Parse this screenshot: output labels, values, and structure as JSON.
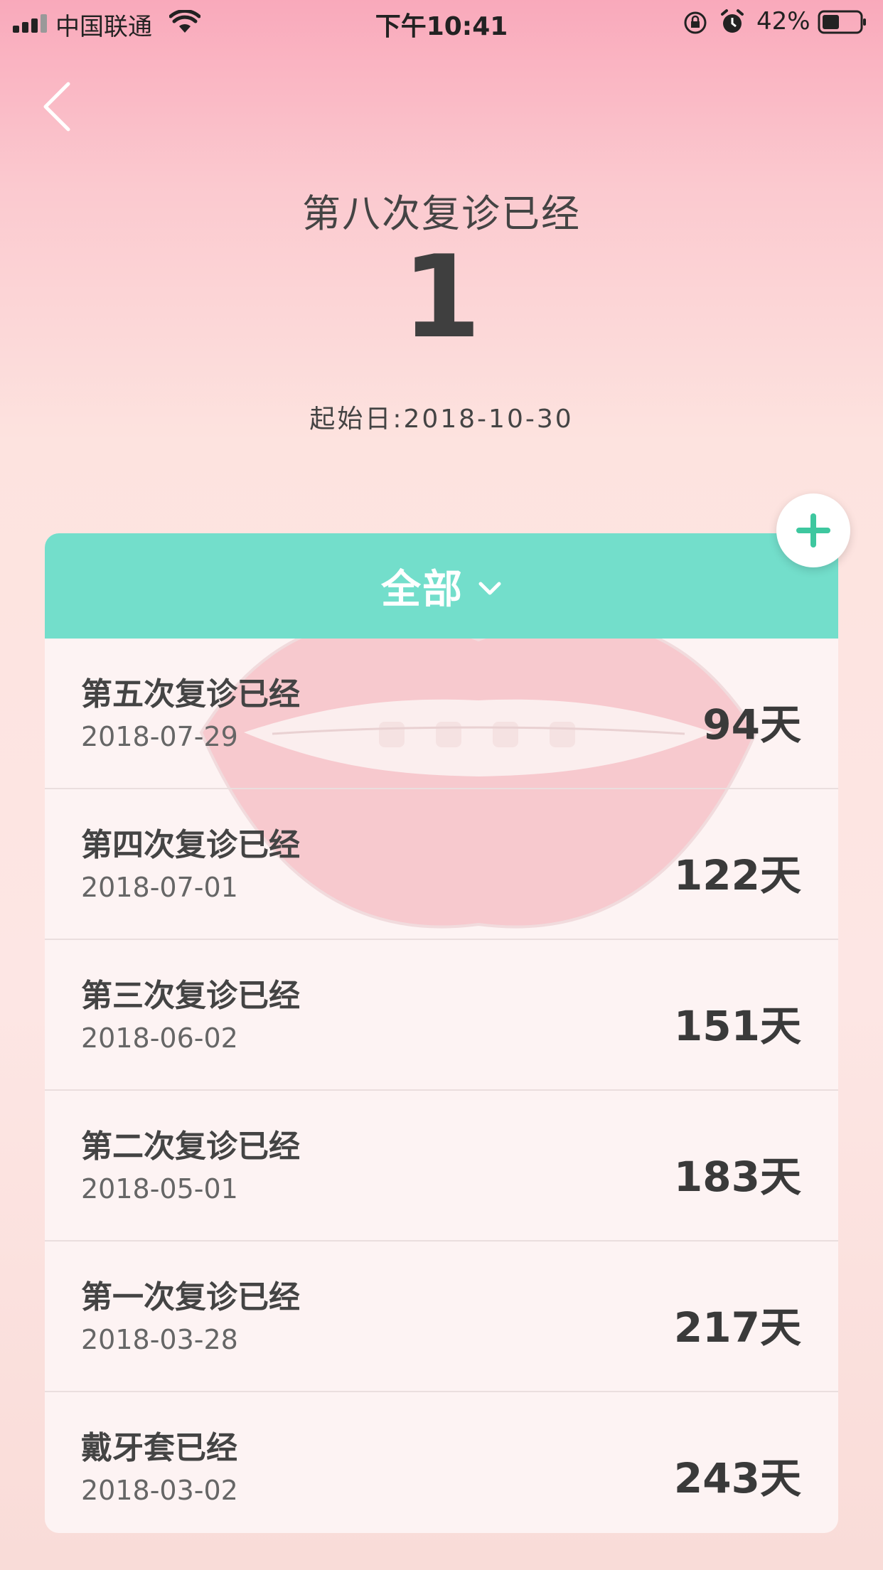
{
  "status_bar": {
    "carrier": "中国联通",
    "time": "下午10:41",
    "battery": "42%"
  },
  "header": {
    "title": "第八次复诊已经",
    "count": "1",
    "start_date": "起始日:2018-10-30"
  },
  "filter": {
    "label": "全部"
  },
  "records": [
    {
      "title": "第五次复诊已经",
      "date": "2018-07-29",
      "days": "94天"
    },
    {
      "title": "第四次复诊已经",
      "date": "2018-07-01",
      "days": "122天"
    },
    {
      "title": "第三次复诊已经",
      "date": "2018-06-02",
      "days": "151天"
    },
    {
      "title": "第二次复诊已经",
      "date": "2018-05-01",
      "days": "183天"
    },
    {
      "title": "第一次复诊已经",
      "date": "2018-03-28",
      "days": "217天"
    },
    {
      "title": "戴牙套已经",
      "date": "2018-03-02",
      "days": "243天"
    }
  ],
  "icons": {
    "back": "chevron-left-icon",
    "add": "plus-icon",
    "dropdown": "chevron-down-icon"
  },
  "colors": {
    "accent": "#73decb",
    "add_icon": "#3ec79f"
  }
}
